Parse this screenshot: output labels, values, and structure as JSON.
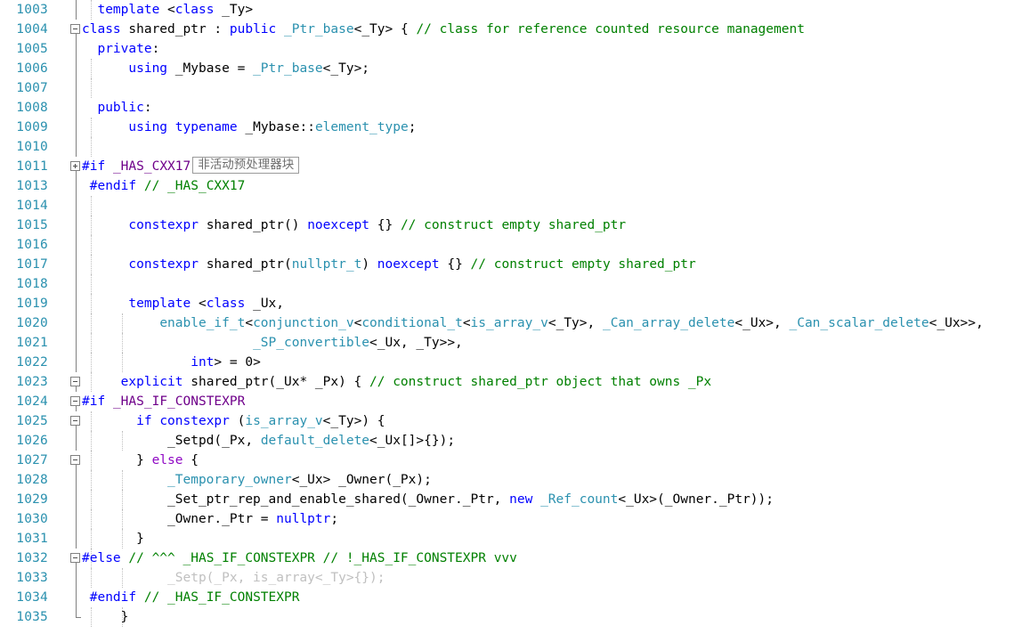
{
  "editor": {
    "app": "visual-studio-code-editor",
    "language": "C++",
    "first_line": 1003,
    "colors": {
      "background": "#ffffff",
      "line_number": "#2b91af",
      "keyword": "#0000ff",
      "comment": "#008000",
      "type": "#2b91af",
      "preprocessor_macro": "#6f008a",
      "control_keyword": "#8f08c4",
      "inactive_code": "#c0c0c0",
      "fold_margin": "#808080",
      "indent_guide": "#bfbfbf"
    },
    "collapsed_region_badge": "非活动预处理器块"
  },
  "lines": [
    {
      "num": "1003",
      "fold": "line",
      "indent_guides": [
        0
      ],
      "tokens": [
        {
          "t": "  ",
          "c": "pun"
        },
        {
          "t": "template",
          "c": "kw"
        },
        {
          "t": " <",
          "c": "pun"
        },
        {
          "t": "class",
          "c": "kw"
        },
        {
          "t": " _Ty>",
          "c": "pun"
        }
      ]
    },
    {
      "num": "1004",
      "fold": "box",
      "indent_guides": [],
      "tokens": [
        {
          "t": "class",
          "c": "kw"
        },
        {
          "t": " shared_ptr ",
          "c": "pun"
        },
        {
          "t": ":",
          "c": "pun"
        },
        {
          "t": " ",
          "c": "pun"
        },
        {
          "t": "public",
          "c": "kw"
        },
        {
          "t": " ",
          "c": "pun"
        },
        {
          "t": "_Ptr_base",
          "c": "typ"
        },
        {
          "t": "<_Ty> { ",
          "c": "pun"
        },
        {
          "t": "// class for reference counted resource management",
          "c": "cmt"
        }
      ]
    },
    {
      "num": "1005",
      "fold": "line",
      "indent_guides": [],
      "tokens": [
        {
          "t": "  ",
          "c": "pun"
        },
        {
          "t": "private",
          "c": "kw"
        },
        {
          "t": ":",
          "c": "pun"
        }
      ]
    },
    {
      "num": "1006",
      "fold": "line",
      "indent_guides": [
        0
      ],
      "tokens": [
        {
          "t": "      ",
          "c": "pun"
        },
        {
          "t": "using",
          "c": "kw"
        },
        {
          "t": " _Mybase = ",
          "c": "pun"
        },
        {
          "t": "_Ptr_base",
          "c": "typ"
        },
        {
          "t": "<_Ty>;",
          "c": "pun"
        }
      ]
    },
    {
      "num": "1007",
      "fold": "line",
      "indent_guides": [
        0
      ],
      "tokens": []
    },
    {
      "num": "1008",
      "fold": "line",
      "indent_guides": [],
      "tokens": [
        {
          "t": "  ",
          "c": "pun"
        },
        {
          "t": "public",
          "c": "kw"
        },
        {
          "t": ":",
          "c": "pun"
        }
      ]
    },
    {
      "num": "1009",
      "fold": "line",
      "indent_guides": [
        0
      ],
      "tokens": [
        {
          "t": "      ",
          "c": "pun"
        },
        {
          "t": "using",
          "c": "kw"
        },
        {
          "t": " ",
          "c": "pun"
        },
        {
          "t": "typename",
          "c": "kw"
        },
        {
          "t": " _Mybase::",
          "c": "pun"
        },
        {
          "t": "element_type",
          "c": "typ"
        },
        {
          "t": ";",
          "c": "pun"
        }
      ]
    },
    {
      "num": "1010",
      "fold": "line",
      "indent_guides": [
        0
      ],
      "tokens": []
    },
    {
      "num": "1011",
      "fold": "box-plus",
      "indent_guides": [],
      "tokens": [
        {
          "t": "#if",
          "c": "pp"
        },
        {
          "t": " ",
          "c": "pun"
        },
        {
          "t": "_HAS_CXX17",
          "c": "ppm"
        }
      ],
      "badge": "非活动预处理器块"
    },
    {
      "num": "1013",
      "fold": "line",
      "indent_guides": [],
      "tokens": [
        {
          "t": " ",
          "c": "pun"
        },
        {
          "t": "#endif",
          "c": "pp"
        },
        {
          "t": " ",
          "c": "pun"
        },
        {
          "t": "// _HAS_CXX17",
          "c": "cmt"
        }
      ]
    },
    {
      "num": "1014",
      "fold": "line",
      "indent_guides": [
        0
      ],
      "tokens": []
    },
    {
      "num": "1015",
      "fold": "line",
      "indent_guides": [
        0
      ],
      "tokens": [
        {
          "t": "      ",
          "c": "pun"
        },
        {
          "t": "constexpr",
          "c": "kw"
        },
        {
          "t": " shared_ptr() ",
          "c": "pun"
        },
        {
          "t": "noexcept",
          "c": "kw"
        },
        {
          "t": " {} ",
          "c": "pun"
        },
        {
          "t": "// construct empty shared_ptr",
          "c": "cmt"
        }
      ]
    },
    {
      "num": "1016",
      "fold": "line",
      "indent_guides": [
        0
      ],
      "tokens": []
    },
    {
      "num": "1017",
      "fold": "line",
      "indent_guides": [
        0
      ],
      "tokens": [
        {
          "t": "      ",
          "c": "pun"
        },
        {
          "t": "constexpr",
          "c": "kw"
        },
        {
          "t": " shared_ptr(",
          "c": "pun"
        },
        {
          "t": "nullptr_t",
          "c": "typ"
        },
        {
          "t": ") ",
          "c": "pun"
        },
        {
          "t": "noexcept",
          "c": "kw"
        },
        {
          "t": " {} ",
          "c": "pun"
        },
        {
          "t": "// construct empty shared_ptr",
          "c": "cmt"
        }
      ]
    },
    {
      "num": "1018",
      "fold": "line",
      "indent_guides": [
        0
      ],
      "tokens": []
    },
    {
      "num": "1019",
      "fold": "line",
      "indent_guides": [
        0
      ],
      "tokens": [
        {
          "t": "      ",
          "c": "pun"
        },
        {
          "t": "template",
          "c": "kw"
        },
        {
          "t": " <",
          "c": "pun"
        },
        {
          "t": "class",
          "c": "kw"
        },
        {
          "t": " _Ux,",
          "c": "pun"
        }
      ]
    },
    {
      "num": "1020",
      "fold": "line",
      "indent_guides": [
        0,
        1
      ],
      "tokens": [
        {
          "t": "          ",
          "c": "pun"
        },
        {
          "t": "enable_if_t",
          "c": "typ"
        },
        {
          "t": "<",
          "c": "pun"
        },
        {
          "t": "conjunction_v",
          "c": "typ"
        },
        {
          "t": "<",
          "c": "pun"
        },
        {
          "t": "conditional_t",
          "c": "typ"
        },
        {
          "t": "<",
          "c": "pun"
        },
        {
          "t": "is_array_v",
          "c": "typ"
        },
        {
          "t": "<_Ty>, ",
          "c": "pun"
        },
        {
          "t": "_Can_array_delete",
          "c": "typ"
        },
        {
          "t": "<_Ux>, ",
          "c": "pun"
        },
        {
          "t": "_Can_scalar_delete",
          "c": "typ"
        },
        {
          "t": "<_Ux>>,",
          "c": "pun"
        }
      ]
    },
    {
      "num": "1021",
      "fold": "line",
      "indent_guides": [
        0,
        1
      ],
      "tokens": [
        {
          "t": "                      ",
          "c": "pun"
        },
        {
          "t": "_SP_convertible",
          "c": "typ"
        },
        {
          "t": "<_Ux, _Ty>>,",
          "c": "pun"
        }
      ]
    },
    {
      "num": "1022",
      "fold": "line",
      "indent_guides": [
        0,
        1
      ],
      "tokens": [
        {
          "t": "              ",
          "c": "pun"
        },
        {
          "t": "int",
          "c": "kw"
        },
        {
          "t": "> = 0>",
          "c": "pun"
        }
      ]
    },
    {
      "num": "1023",
      "fold": "box",
      "indent_guides": [
        0
      ],
      "tokens": [
        {
          "t": "     ",
          "c": "pun"
        },
        {
          "t": "explicit",
          "c": "kw"
        },
        {
          "t": " shared_ptr(_Ux* _Px) { ",
          "c": "pun"
        },
        {
          "t": "// construct shared_ptr object that owns _Px",
          "c": "cmt"
        }
      ]
    },
    {
      "num": "1024",
      "fold": "box",
      "indent_guides": [],
      "tokens": [
        {
          "t": "#if",
          "c": "pp"
        },
        {
          "t": " ",
          "c": "pun"
        },
        {
          "t": "_HAS_IF_CONSTEXPR",
          "c": "ppm"
        }
      ]
    },
    {
      "num": "1025",
      "fold": "box",
      "indent_guides": [
        0
      ],
      "tokens": [
        {
          "t": "       ",
          "c": "pun"
        },
        {
          "t": "if",
          "c": "kw"
        },
        {
          "t": " ",
          "c": "pun"
        },
        {
          "t": "constexpr",
          "c": "kw"
        },
        {
          "t": " (",
          "c": "pun"
        },
        {
          "t": "is_array_v",
          "c": "typ"
        },
        {
          "t": "<_Ty>) {",
          "c": "pun"
        }
      ]
    },
    {
      "num": "1026",
      "fold": "bar",
      "indent_guides": [
        0,
        1
      ],
      "tokens": [
        {
          "t": "           ",
          "c": "pun"
        },
        {
          "t": "_Setpd",
          "c": "pun"
        },
        {
          "t": "(_Px, ",
          "c": "pun"
        },
        {
          "t": "default_delete",
          "c": "typ"
        },
        {
          "t": "<_Ux[]>{});",
          "c": "pun"
        }
      ]
    },
    {
      "num": "1027",
      "fold": "box",
      "indent_guides": [
        0
      ],
      "tokens": [
        {
          "t": "       ",
          "c": "pun"
        },
        {
          "t": "} ",
          "c": "pun"
        },
        {
          "t": "else",
          "c": "ctl"
        },
        {
          "t": " {",
          "c": "pun"
        }
      ]
    },
    {
      "num": "1028",
      "fold": "bar",
      "indent_guides": [
        0,
        1
      ],
      "tokens": [
        {
          "t": "           ",
          "c": "pun"
        },
        {
          "t": "_Temporary_owner",
          "c": "typ"
        },
        {
          "t": "<_Ux> _Owner(_Px);",
          "c": "pun"
        }
      ]
    },
    {
      "num": "1029",
      "fold": "bar",
      "indent_guides": [
        0,
        1
      ],
      "tokens": [
        {
          "t": "           ",
          "c": "pun"
        },
        {
          "t": "_Set_ptr_rep_and_enable_shared(_Owner._Ptr, ",
          "c": "pun"
        },
        {
          "t": "new",
          "c": "kw"
        },
        {
          "t": " ",
          "c": "pun"
        },
        {
          "t": "_Ref_count",
          "c": "typ"
        },
        {
          "t": "<_Ux>(_Owner._Ptr));",
          "c": "pun"
        }
      ]
    },
    {
      "num": "1030",
      "fold": "bar",
      "indent_guides": [
        0,
        1
      ],
      "tokens": [
        {
          "t": "           ",
          "c": "pun"
        },
        {
          "t": "_Owner._Ptr = ",
          "c": "pun"
        },
        {
          "t": "nullptr",
          "c": "kw"
        },
        {
          "t": ";",
          "c": "pun"
        }
      ]
    },
    {
      "num": "1031",
      "fold": "bar",
      "indent_guides": [
        0,
        1
      ],
      "tokens": [
        {
          "t": "       ",
          "c": "pun"
        },
        {
          "t": "}",
          "c": "pun"
        }
      ]
    },
    {
      "num": "1032",
      "fold": "box",
      "indent_guides": [
        0
      ],
      "tokens": [
        {
          "t": "#else",
          "c": "pp"
        },
        {
          "t": " ",
          "c": "pun"
        },
        {
          "t": "// ^^^ _HAS_IF_CONSTEXPR // !_HAS_IF_CONSTEXPR vvv",
          "c": "cmt"
        }
      ]
    },
    {
      "num": "1033",
      "fold": "bar",
      "indent_guides": [
        0,
        1
      ],
      "inactive": true,
      "tokens": [
        {
          "t": "           ",
          "c": "pun"
        },
        {
          "t": "_Setp(_Px, is_array<_Ty>{});",
          "c": "pun"
        }
      ]
    },
    {
      "num": "1034",
      "fold": "bar",
      "indent_guides": [],
      "tokens": [
        {
          "t": " ",
          "c": "pun"
        },
        {
          "t": "#endif",
          "c": "pp"
        },
        {
          "t": " ",
          "c": "pun"
        },
        {
          "t": "// _HAS_IF_CONSTEXPR",
          "c": "cmt"
        }
      ]
    },
    {
      "num": "1035",
      "fold": "bar-end",
      "indent_guides": [
        0,
        1
      ],
      "tokens": [
        {
          "t": "     ",
          "c": "pun"
        },
        {
          "t": "}",
          "c": "pun"
        }
      ]
    }
  ]
}
